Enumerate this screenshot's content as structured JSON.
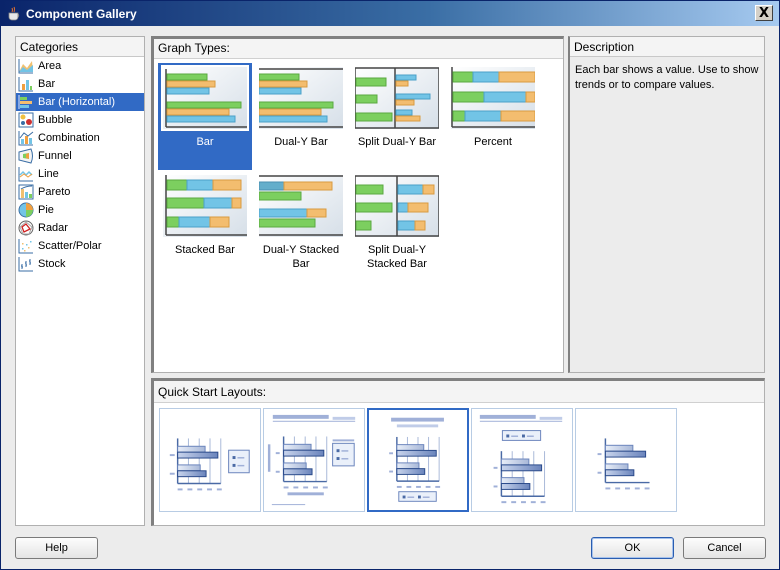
{
  "window": {
    "title": "Component Gallery",
    "close_label": "X"
  },
  "categories": {
    "header": "Categories",
    "header_mnemonic": "C",
    "items": [
      {
        "label": "Area",
        "icon": "area-chart-icon",
        "selected": false
      },
      {
        "label": "Bar",
        "icon": "bar-chart-icon",
        "selected": false
      },
      {
        "label": "Bar (Horizontal)",
        "icon": "horizontal-bar-chart-icon",
        "selected": true
      },
      {
        "label": "Bubble",
        "icon": "bubble-chart-icon",
        "selected": false
      },
      {
        "label": "Combination",
        "icon": "combination-chart-icon",
        "selected": false
      },
      {
        "label": "Funnel",
        "icon": "funnel-chart-icon",
        "selected": false
      },
      {
        "label": "Line",
        "icon": "line-chart-icon",
        "selected": false
      },
      {
        "label": "Pareto",
        "icon": "pareto-chart-icon",
        "selected": false
      },
      {
        "label": "Pie",
        "icon": "pie-chart-icon",
        "selected": false
      },
      {
        "label": "Radar",
        "icon": "radar-chart-icon",
        "selected": false
      },
      {
        "label": "Scatter/Polar",
        "icon": "scatter-chart-icon",
        "selected": false
      },
      {
        "label": "Stock",
        "icon": "stock-chart-icon",
        "selected": false
      }
    ]
  },
  "graph_types": {
    "header": "Graph Types:",
    "items": [
      {
        "label": "Bar",
        "selected": true
      },
      {
        "label": "Dual-Y Bar",
        "selected": false
      },
      {
        "label": "Split Dual-Y Bar",
        "selected": false
      },
      {
        "label": "Percent",
        "selected": false
      },
      {
        "label": "Stacked Bar",
        "selected": false
      },
      {
        "label": "Dual-Y Stacked Bar",
        "selected": false
      },
      {
        "label": "Split Dual-Y Stacked Bar",
        "selected": false
      }
    ]
  },
  "description": {
    "header": "Description",
    "text": "Each bar shows a value. Use to show trends or to compare values."
  },
  "quick_start": {
    "header": "Quick Start Layouts:",
    "layouts": [
      {
        "name": "legend-right",
        "selected": false
      },
      {
        "name": "title-legend-right-axis-titles",
        "selected": false
      },
      {
        "name": "title-legend-bottom",
        "selected": true
      },
      {
        "name": "title-legend-top",
        "selected": false
      },
      {
        "name": "chart-only",
        "selected": false
      }
    ]
  },
  "buttons": {
    "help": "Help",
    "ok": "OK",
    "cancel": "Cancel"
  },
  "colors": {
    "selection": "#316ac5",
    "bar_green": "#7ccf5f",
    "bar_orange": "#f3bd6f",
    "bar_blue": "#72c4e6",
    "layout_blue": "#4a6aa5"
  }
}
